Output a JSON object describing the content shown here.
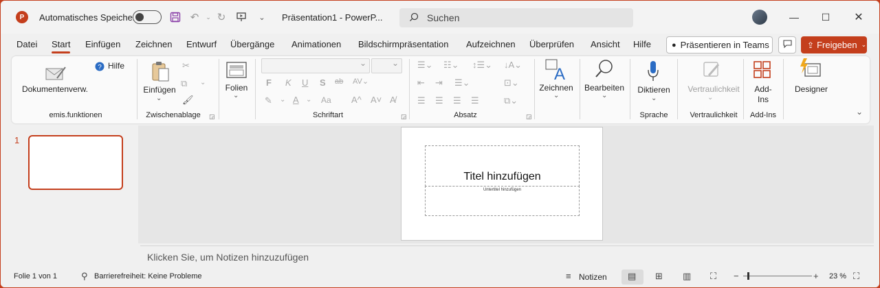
{
  "titlebar": {
    "app_icon_letter": "P",
    "autosave_label": "Automatisches Speichern",
    "document_title": "Präsentation1  -  PowerP...",
    "search_placeholder": "Suchen",
    "qat_icons": [
      "save-icon",
      "undo-icon",
      "redo-icon",
      "present-from-start-icon",
      "customize-qat-icon"
    ]
  },
  "menu": {
    "tabs": [
      "Datei",
      "Start",
      "Einfügen",
      "Zeichnen",
      "Entwurf",
      "Übergänge",
      "Animationen",
      "Bildschirmpräsentation",
      "Aufzeichnen",
      "Überprüfen",
      "Ansicht",
      "Hilfe"
    ],
    "active_tab": "Start",
    "teams_label": "Präsentieren in Teams",
    "share_label": "Freigeben"
  },
  "ribbon": {
    "docs_label": "Dokumentenverw.",
    "help_label": "Hilfe",
    "group1_label": "emis.funktionen",
    "paste_label": "Einfügen",
    "clipboard_label": "Zwischenablage",
    "slides_label": "Folien",
    "font_label": "Schriftart",
    "bold": "F",
    "italic": "K",
    "underline": "U",
    "shadow": "S",
    "strike": "ab",
    "font_size_grow": "A^",
    "font_size_shrink": "A˅",
    "change_case": "Aa",
    "paragraph_label": "Absatz",
    "draw_label": "Zeichnen",
    "edit_label": "Bearbeiten",
    "dictate_label": "Diktieren",
    "voice_label": "Sprache",
    "sensitivity_btn_label": "Vertraulichkeit",
    "sensitivity_group_label": "Vertraulichkeit",
    "addins_btn_label": "Add-\nIns",
    "addins_group_label": "Add-Ins",
    "designer_label": "Designer"
  },
  "slides_pane": {
    "slide_number": "1"
  },
  "slide": {
    "title_placeholder": "Titel hinzufügen",
    "subtitle_placeholder": "Untertitel hinzufügen"
  },
  "notes": {
    "placeholder": "Klicken Sie, um Notizen hinzuzufügen"
  },
  "status": {
    "slide_info": "Folie 1 von 1",
    "accessibility": "Barrierefreiheit: Keine Probleme",
    "notes_button": "Notizen",
    "zoom_level": "23 %",
    "zoom_fraction": 0.23
  },
  "colors": {
    "accent": "#c43e1c",
    "ribbon_bg": "#fafafa",
    "window_bg": "#f0f0f0"
  }
}
